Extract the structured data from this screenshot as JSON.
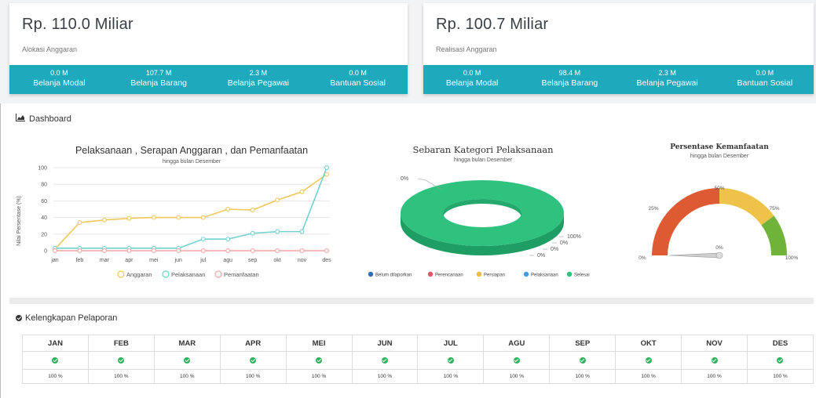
{
  "alokasi": {
    "amount": "Rp. 110.0 Miliar",
    "label": "Alokasi Anggaran",
    "items": [
      {
        "value": "0.0 M",
        "label": "Belanja Modal"
      },
      {
        "value": "107.7 M",
        "label": "Belanja Barang"
      },
      {
        "value": "2.3 M",
        "label": "Belanja Pegawai"
      },
      {
        "value": "0.0 M",
        "label": "Bantuan Sosial"
      }
    ]
  },
  "realisasi": {
    "amount": "Rp. 100.7 Miliar",
    "label": "Realisasi Anggaran",
    "items": [
      {
        "value": "0.0 M",
        "label": "Belanja Modal"
      },
      {
        "value": "98.4 M",
        "label": "Belanja Barang"
      },
      {
        "value": "2.3 M",
        "label": "Belanja Pegawai"
      },
      {
        "value": "0.0 M",
        "label": "Bantuan Sosial"
      }
    ]
  },
  "dashboard_title": "Dashboard",
  "colors": {
    "accent": "#1fa9bd",
    "ok": "#2fb35b",
    "anggaran": "#f1c75a",
    "pelaksanaan": "#6fd3cf",
    "pemanfaatan": "#f3a6a6",
    "donut": "#2ec27e"
  },
  "chart_data": [
    {
      "type": "line",
      "title": "Pelaksanaan , Serapan Anggaran , dan Pemanfaatan",
      "subtitle": "hingga bulan Desember",
      "ylabel": "Nilai Persentase (%)",
      "ylim": [
        0,
        100
      ],
      "yticks": [
        0,
        20,
        40,
        60,
        80,
        100
      ],
      "categories": [
        "jan",
        "feb",
        "mar",
        "apr",
        "mei",
        "jun",
        "jul",
        "agu",
        "sep",
        "okt",
        "nov",
        "des"
      ],
      "series": [
        {
          "name": "Anggaran",
          "values": [
            2,
            34,
            37,
            39,
            40,
            40,
            40,
            50,
            49,
            61,
            71,
            92
          ]
        },
        {
          "name": "Pelaksanaan",
          "values": [
            3,
            3,
            3,
            3,
            3,
            3,
            14,
            14,
            21,
            23,
            23,
            100
          ]
        },
        {
          "name": "Pemanfaatan",
          "values": [
            0,
            0,
            0,
            0,
            0,
            0,
            0,
            0,
            0,
            0,
            0,
            0
          ]
        }
      ],
      "legend": "bottom"
    },
    {
      "type": "pie",
      "title": "Sebaran Kategori Pelaksanaan",
      "subtitle": "hingga bulan Desember",
      "categories": [
        "Belum dilaporkan",
        "Perencanaan",
        "Persiapan",
        "Pelaksanaan",
        "Selesai"
      ],
      "values": [
        0,
        0,
        0,
        0,
        100
      ],
      "labels": [
        "100%",
        "0%",
        "0%",
        "0%",
        "0%"
      ],
      "legend": "bottom"
    },
    {
      "type": "gauge",
      "title": "Persentase Kemanfaatan",
      "subtitle": "hingga bulan Desember",
      "value": 0,
      "value_label": "0%",
      "range": [
        0,
        100
      ],
      "tick_labels": [
        "0%",
        "25%",
        "50%",
        "75%",
        "100%"
      ]
    }
  ],
  "kelengkapan": {
    "title": "Kelengkapan Pelaporan",
    "months": [
      "JAN",
      "FEB",
      "MAR",
      "APR",
      "MEI",
      "JUN",
      "JUL",
      "AGU",
      "SEP",
      "OKT",
      "NOV",
      "DES"
    ],
    "percent": [
      "100 %",
      "100 %",
      "100 %",
      "100 %",
      "100 %",
      "100 %",
      "100 %",
      "100 %",
      "100 %",
      "100 %",
      "100 %",
      "100 %"
    ]
  }
}
